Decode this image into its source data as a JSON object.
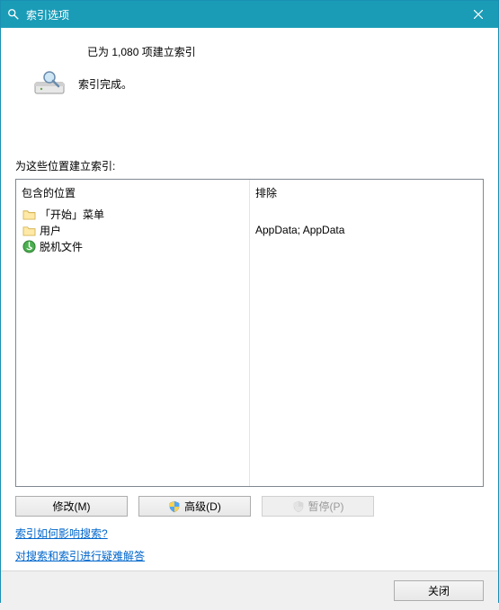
{
  "title": "索引选项",
  "status": {
    "count_text": "已为 1,080 项建立索引",
    "completion_text": "索引完成。"
  },
  "section_label": "为这些位置建立索引:",
  "columns": {
    "included_header": "包含的位置",
    "excluded_header": "排除"
  },
  "included": [
    {
      "label": "「开始」菜单",
      "icon": "folder"
    },
    {
      "label": "用户",
      "icon": "folder"
    },
    {
      "label": "脱机文件",
      "icon": "offline"
    }
  ],
  "excluded": [
    "",
    "AppData; AppData"
  ],
  "buttons": {
    "modify": "修改(M)",
    "advanced": "高级(D)",
    "pause": "暂停(P)",
    "close": "关闭"
  },
  "links": {
    "how_affects": "索引如何影响搜索?",
    "troubleshoot": "对搜索和索引进行疑难解答"
  }
}
